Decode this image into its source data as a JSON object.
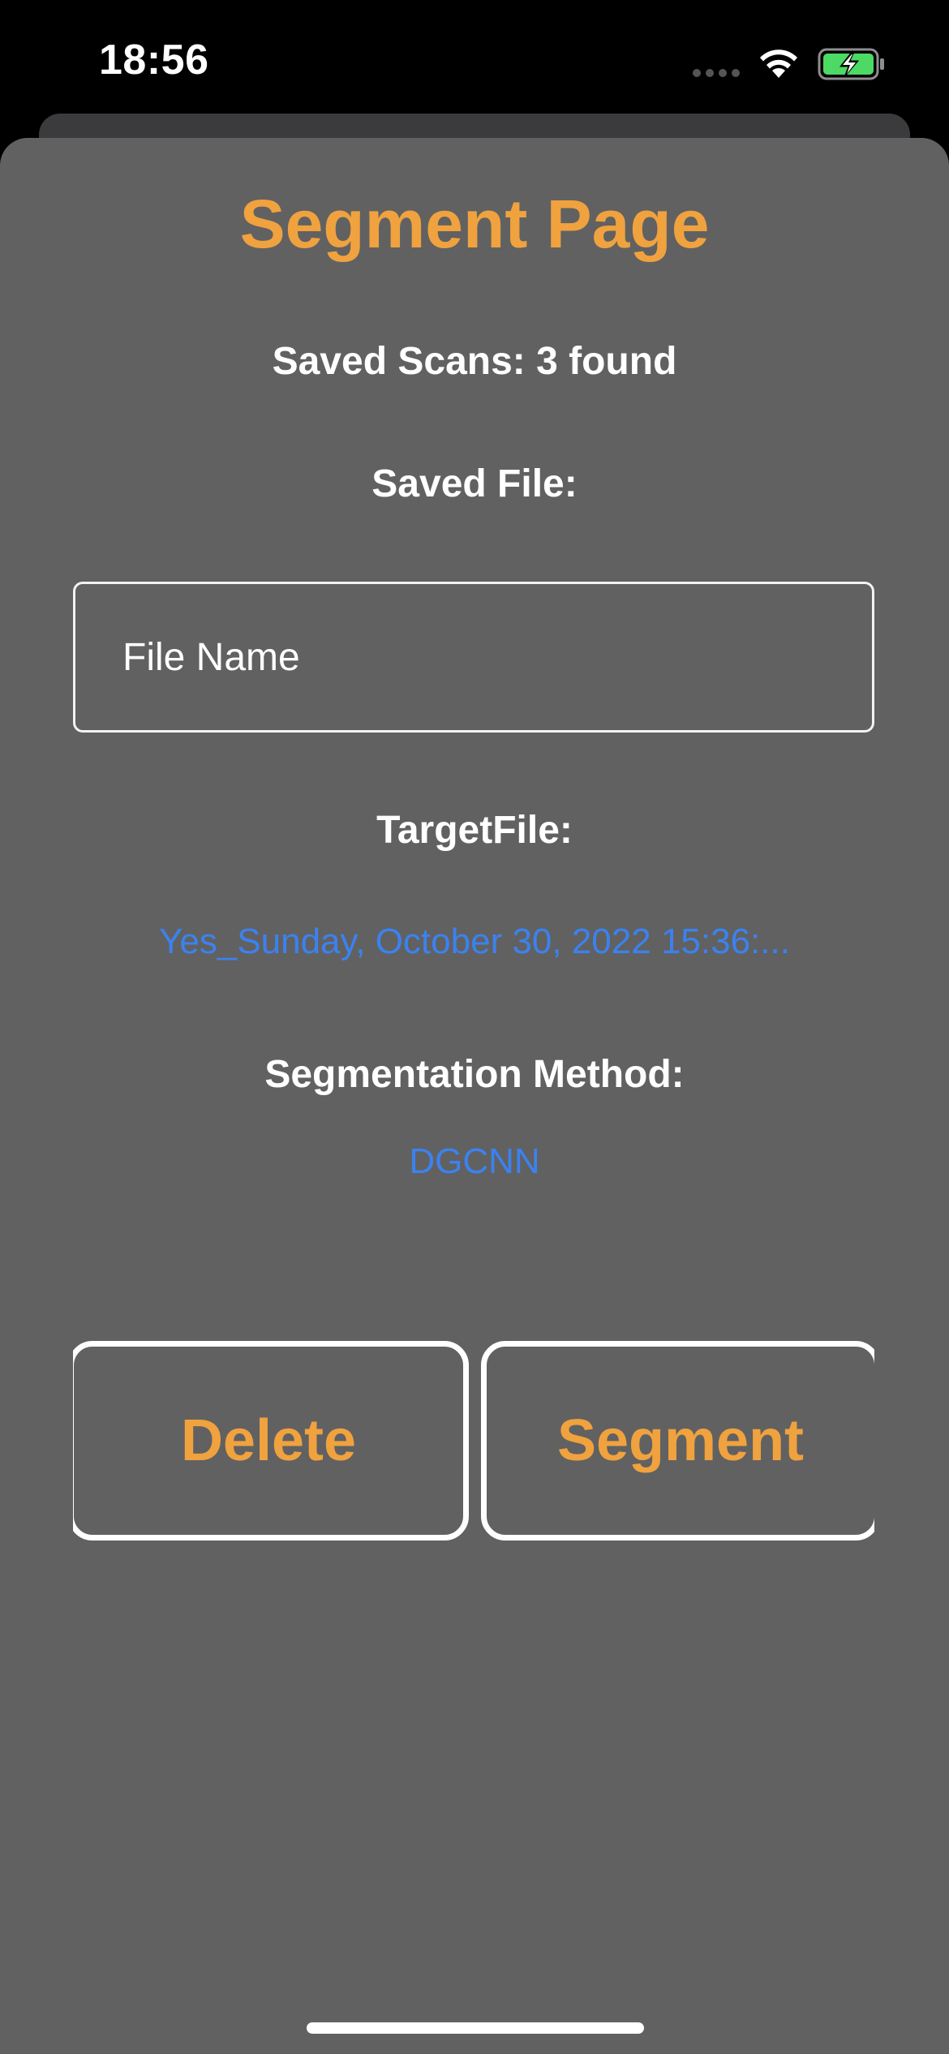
{
  "status_bar": {
    "time": "18:56"
  },
  "page": {
    "title": "Segment Page",
    "saved_scans_label": "Saved Scans: 3 found",
    "saved_file_label": "Saved File:",
    "file_name_placeholder": "File Name",
    "target_file_label": "TargetFile:",
    "target_file_value": "Yes_Sunday, October 30, 2022 15:36:...",
    "segmentation_method_label": "Segmentation Method:",
    "segmentation_method_value": "DGCNN"
  },
  "actions": {
    "delete_label": "Delete",
    "segment_label": "Segment"
  },
  "colors": {
    "accent": "#f0a23f",
    "link": "#3b82f0",
    "sheet_background": "#616161",
    "battery_fill": "#4cd964"
  }
}
